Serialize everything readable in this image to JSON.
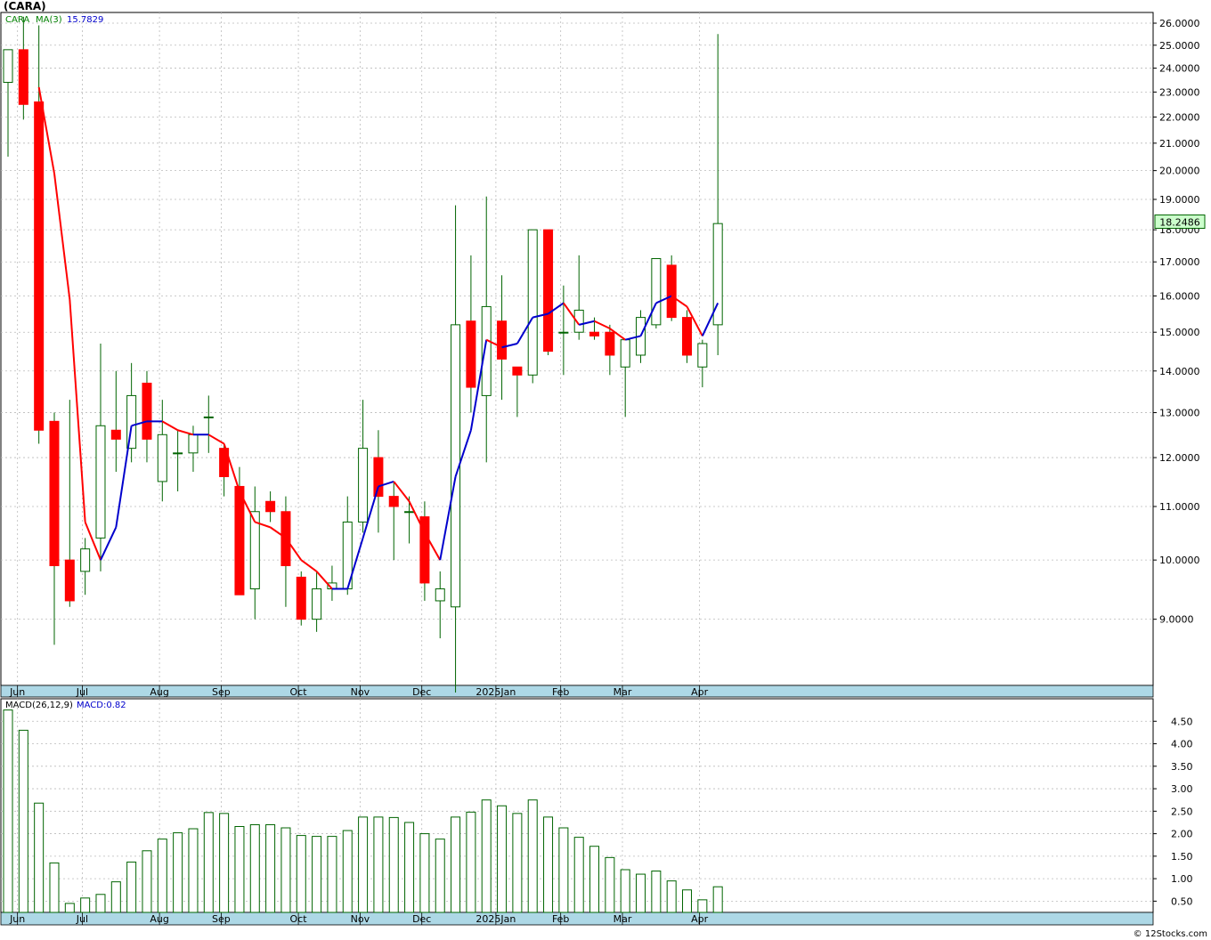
{
  "header": {
    "title": "(CARA)"
  },
  "legend_main": {
    "symbol": "CARA",
    "ma_label": "MA(3)",
    "ma_value": "15.7829"
  },
  "legend_macd": {
    "label": "MACD(26,12,9)",
    "value_label": "MACD:0.82"
  },
  "last_price_label": "18.2486",
  "footer": {
    "copyright": "© 12Stocks.com"
  },
  "colors": {
    "up_candle": "#006400",
    "down_candle": "#ff0000",
    "wick": "#006400",
    "ma_up": "#0000cc",
    "ma_down": "#ff0000",
    "axis_bar": "#add8e6",
    "grid": "#bbbbbb",
    "macd_bar": "#006400",
    "last_price_bg": "#ccffcc"
  },
  "chart_data": [
    {
      "type": "candlestick",
      "title": "(CARA)",
      "scale": "log",
      "ylim": [
        8.0,
        26.5
      ],
      "y_ticks": [
        "9.0000",
        "10.0000",
        "11.0000",
        "12.0000",
        "13.0000",
        "14.0000",
        "15.0000",
        "16.0000",
        "17.0000",
        "18.0000",
        "19.0000",
        "20.0000",
        "21.0000",
        "22.0000",
        "23.0000",
        "24.0000",
        "25.0000",
        "26.0000"
      ],
      "x_labels": [
        "Jun",
        "Jul",
        "Aug",
        "Sep",
        "Oct",
        "Nov",
        "Dec",
        "2025Jan",
        "Feb",
        "Mar",
        "Apr"
      ],
      "x_label_index": [
        1,
        5.2,
        10.2,
        14.2,
        19.2,
        23.2,
        27.2,
        32,
        36.2,
        40.2,
        45.2
      ],
      "candles": [
        {
          "o": 23.4,
          "h": 24.8,
          "l": 20.5,
          "c": 24.8
        },
        {
          "o": 24.8,
          "h": 26.3,
          "l": 21.9,
          "c": 22.5
        },
        {
          "o": 22.6,
          "h": 25.9,
          "l": 12.3,
          "c": 12.6
        },
        {
          "o": 12.8,
          "h": 13.0,
          "l": 8.6,
          "c": 9.9
        },
        {
          "o": 10.0,
          "h": 13.3,
          "l": 9.2,
          "c": 9.3
        },
        {
          "o": 9.8,
          "h": 10.4,
          "l": 9.4,
          "c": 10.2
        },
        {
          "o": 10.4,
          "h": 14.7,
          "l": 9.8,
          "c": 12.7
        },
        {
          "o": 12.6,
          "h": 14.0,
          "l": 11.7,
          "c": 12.4
        },
        {
          "o": 12.2,
          "h": 14.2,
          "l": 11.9,
          "c": 13.4
        },
        {
          "o": 13.7,
          "h": 14.0,
          "l": 11.9,
          "c": 12.4
        },
        {
          "o": 11.5,
          "h": 13.3,
          "l": 11.1,
          "c": 12.5
        },
        {
          "o": 12.1,
          "h": 12.6,
          "l": 11.3,
          "c": 12.1
        },
        {
          "o": 12.1,
          "h": 12.7,
          "l": 11.7,
          "c": 12.5
        },
        {
          "o": 12.9,
          "h": 13.4,
          "l": 12.1,
          "c": 12.9
        },
        {
          "o": 12.2,
          "h": 12.3,
          "l": 11.2,
          "c": 11.6
        },
        {
          "o": 11.4,
          "h": 11.8,
          "l": 9.4,
          "c": 9.4
        },
        {
          "o": 9.5,
          "h": 11.4,
          "l": 9.0,
          "c": 10.9
        },
        {
          "o": 11.1,
          "h": 11.3,
          "l": 10.7,
          "c": 10.9
        },
        {
          "o": 10.9,
          "h": 11.2,
          "l": 9.2,
          "c": 9.9
        },
        {
          "o": 9.7,
          "h": 9.8,
          "l": 8.9,
          "c": 9.0
        },
        {
          "o": 9.0,
          "h": 9.8,
          "l": 8.8,
          "c": 9.5
        },
        {
          "o": 9.5,
          "h": 9.9,
          "l": 9.3,
          "c": 9.6
        },
        {
          "o": 9.5,
          "h": 11.2,
          "l": 9.4,
          "c": 10.7
        },
        {
          "o": 10.7,
          "h": 13.3,
          "l": 10.5,
          "c": 12.2
        },
        {
          "o": 12.0,
          "h": 12.6,
          "l": 10.5,
          "c": 11.2
        },
        {
          "o": 11.2,
          "h": 11.5,
          "l": 10.0,
          "c": 11.0
        },
        {
          "o": 10.9,
          "h": 11.2,
          "l": 10.3,
          "c": 10.9
        },
        {
          "o": 10.8,
          "h": 11.1,
          "l": 9.3,
          "c": 9.6
        },
        {
          "o": 9.3,
          "h": 9.8,
          "l": 8.7,
          "c": 9.5
        },
        {
          "o": 9.2,
          "h": 18.8,
          "l": 7.9,
          "c": 15.2
        },
        {
          "o": 15.3,
          "h": 17.2,
          "l": 13.0,
          "c": 13.6
        },
        {
          "o": 13.4,
          "h": 19.1,
          "l": 11.9,
          "c": 15.7
        },
        {
          "o": 15.3,
          "h": 16.6,
          "l": 13.3,
          "c": 14.3
        },
        {
          "o": 14.1,
          "h": 14.1,
          "l": 12.9,
          "c": 13.9
        },
        {
          "o": 13.9,
          "h": 18.0,
          "l": 13.7,
          "c": 18.0
        },
        {
          "o": 18.0,
          "h": 18.0,
          "l": 14.4,
          "c": 14.5
        },
        {
          "o": 15.0,
          "h": 16.3,
          "l": 13.9,
          "c": 15.0
        },
        {
          "o": 15.0,
          "h": 17.2,
          "l": 14.8,
          "c": 15.6
        },
        {
          "o": 15.0,
          "h": 15.4,
          "l": 14.8,
          "c": 14.9
        },
        {
          "o": 15.0,
          "h": 15.2,
          "l": 13.9,
          "c": 14.4
        },
        {
          "o": 14.1,
          "h": 14.7,
          "l": 12.9,
          "c": 14.8
        },
        {
          "o": 14.4,
          "h": 15.6,
          "l": 14.2,
          "c": 15.4
        },
        {
          "o": 15.2,
          "h": 17.1,
          "l": 15.1,
          "c": 17.1
        },
        {
          "o": 16.9,
          "h": 17.2,
          "l": 15.3,
          "c": 15.4
        },
        {
          "o": 15.4,
          "h": 15.6,
          "l": 14.2,
          "c": 14.4
        },
        {
          "o": 14.1,
          "h": 14.8,
          "l": 13.6,
          "c": 14.7
        },
        {
          "o": 15.2,
          "h": 25.5,
          "l": 14.4,
          "c": 18.2
        }
      ],
      "ma": [
        null,
        null,
        23.2,
        19.9,
        15.9,
        10.7,
        10.0,
        10.6,
        12.7,
        12.8,
        12.8,
        12.6,
        12.5,
        12.5,
        12.3,
        11.3,
        10.7,
        10.6,
        10.4,
        10.0,
        9.8,
        9.5,
        9.5,
        10.4,
        11.4,
        11.5,
        11.1,
        10.5,
        10.0,
        11.6,
        12.6,
        14.8,
        14.6,
        14.7,
        15.4,
        15.5,
        15.8,
        15.2,
        15.3,
        15.1,
        14.8,
        14.9,
        15.8,
        16.0,
        15.7,
        14.9,
        15.8
      ],
      "last_price": 18.2486
    },
    {
      "type": "bar",
      "title": "MACD(26,12,9)",
      "ylim": [
        0.25,
        5.0
      ],
      "y_ticks": [
        "0.50",
        "1.00",
        "1.50",
        "2.00",
        "2.50",
        "3.00",
        "3.50",
        "4.00",
        "4.50"
      ],
      "x_labels": [
        "Jun",
        "Jul",
        "Aug",
        "Sep",
        "Oct",
        "Nov",
        "Dec",
        "2025Jan",
        "Feb",
        "Mar",
        "Apr"
      ],
      "values": [
        4.75,
        4.3,
        2.68,
        1.35,
        0.45,
        0.57,
        0.65,
        0.93,
        1.37,
        1.62,
        1.88,
        2.02,
        2.11,
        2.47,
        2.45,
        2.16,
        2.2,
        2.2,
        2.13,
        1.96,
        1.94,
        1.94,
        2.07,
        2.37,
        2.37,
        2.36,
        2.25,
        2.0,
        1.88,
        2.37,
        2.48,
        2.75,
        2.62,
        2.45,
        2.75,
        2.37,
        2.13,
        1.92,
        1.72,
        1.47,
        1.2,
        1.1,
        1.17,
        0.95,
        0.75,
        0.53,
        0.82
      ],
      "last_value": 0.82
    }
  ]
}
